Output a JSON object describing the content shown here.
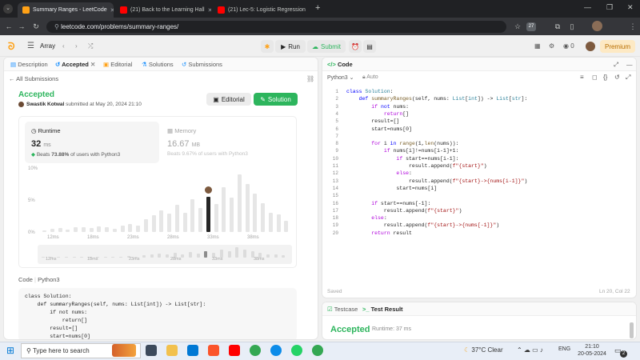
{
  "browser": {
    "tabs": [
      {
        "title": "Summary Ranges - LeetCode",
        "active": true
      },
      {
        "title": "(21) Back to the Learning Hall",
        "active": false
      },
      {
        "title": "(21) Lec-5: Logistic Regression",
        "active": false
      }
    ],
    "url": "leetcode.com/problems/summary-ranges/",
    "badge": "27"
  },
  "nav": {
    "list_label": "Array",
    "run_label": "Run",
    "submit_label": "Submit",
    "coins": "0",
    "premium_label": "Premium"
  },
  "left": {
    "tabs": [
      "Description",
      "Accepted",
      "Editorial",
      "Solutions",
      "Submissions"
    ],
    "back_label": "All Submissions",
    "status": "Accepted",
    "author": "Swastik Kotwal",
    "submitted_text": "submitted at May 20, 2024 21:10",
    "editorial_btn": "Editorial",
    "solution_btn": "Solution",
    "runtime": {
      "label": "Runtime",
      "value": "32",
      "unit": "ms",
      "beats_prefix": "Beats",
      "beats_value": "73.88%",
      "beats_suffix": "of users with Python3"
    },
    "memory": {
      "label": "Memory",
      "value": "16.67",
      "unit": "MB",
      "beats_text": "Beats 9.67% of users with Python3"
    },
    "code_label": "Code",
    "lang_label": "Python3",
    "code_preview": [
      "class Solution:",
      "    def summaryRanges(self, nums: List[int]) -> List[str]:",
      "        if not nums:",
      "            return[]",
      "        result=[]",
      "        start=nums[0]"
    ]
  },
  "chart_data": {
    "type": "bar",
    "ylabels": [
      "10%",
      "5%",
      "0%"
    ],
    "xlabels": [
      "12ms",
      "18ms",
      "23ms",
      "28ms",
      "33ms",
      "38ms"
    ],
    "mini_xlabels": [
      "12ms",
      "18ms",
      "23ms",
      "28ms",
      "33ms",
      "38ms"
    ],
    "ylim": [
      0,
      10
    ],
    "values": [
      0.3,
      0.5,
      0.6,
      0.4,
      0.8,
      0.7,
      0.6,
      0.9,
      0.8,
      0.5,
      1.0,
      1.2,
      1.0,
      2.0,
      2.6,
      3.4,
      2.9,
      4.2,
      3.0,
      5.1,
      3.7,
      5.5,
      4.4,
      7.0,
      5.4,
      9.0,
      7.5,
      6.0,
      4.5,
      3.0,
      2.8,
      1.8
    ],
    "highlight_index": 21
  },
  "editor": {
    "title": "Code",
    "lang": "Python3",
    "mode": "Auto",
    "saved_label": "Saved",
    "cursor_pos": "Ln 20, Col 22"
  },
  "code_lines": [
    {
      "n": "1",
      "html": "<span class='kb'>class</span> <span class='ty'>Solution</span>:"
    },
    {
      "n": "2",
      "html": "    <span class='kb'>def</span> <span class='fn'>summaryRanges</span>(self, nums: <span class='ty'>List</span>[<span class='ty'>int</span>]) -> <span class='ty'>List</span>[<span class='ty'>str</span>]:"
    },
    {
      "n": "3",
      "html": "        <span class='kw'>if</span> <span class='kb'>not</span> nums:"
    },
    {
      "n": "4",
      "html": "            <span class='kw'>return</span>[]"
    },
    {
      "n": "5",
      "html": "        result=[]"
    },
    {
      "n": "6",
      "html": "        start=nums[0]"
    },
    {
      "n": "7",
      "html": ""
    },
    {
      "n": "8",
      "html": "        <span class='kw'>for</span> i <span class='kb'>in</span> <span class='fn'>range</span>(1,<span class='fn'>len</span>(nums)):"
    },
    {
      "n": "9",
      "html": "            <span class='kw'>if</span> nums[i]!=nums[i-1]+1:"
    },
    {
      "n": "10",
      "html": "                <span class='kw'>if</span> start==nums[i-1]:"
    },
    {
      "n": "11",
      "html": "                    result.append(<span class='st'>f\"{start}\"</span>)"
    },
    {
      "n": "12",
      "html": "                <span class='kw'>else</span>:"
    },
    {
      "n": "13",
      "html": "                    result.append(<span class='st'>f\"{start}->{nums[i-1]}\"</span>)"
    },
    {
      "n": "14",
      "html": "                start=nums[i]"
    },
    {
      "n": "15",
      "html": ""
    },
    {
      "n": "16",
      "html": "        <span class='kw'>if</span> start==nums[-1]:"
    },
    {
      "n": "17",
      "html": "            result.append(<span class='st'>f\"{start}\"</span>)"
    },
    {
      "n": "18",
      "html": "        <span class='kw'>else</span>:"
    },
    {
      "n": "19",
      "html": "            result.append(<span class='st'>f\"{start}->{nums[-1]}\"</span>)"
    },
    {
      "n": "20",
      "html": "        <span class='kw'>return</span> result"
    }
  ],
  "bottom": {
    "testcase_tab": "Testcase",
    "result_tab": "Test Result",
    "status": "Accepted",
    "runtime_text": "Runtime: 37 ms"
  },
  "taskbar": {
    "search_placeholder": "Type here to search",
    "weather": "37°C  Clear",
    "lang": "ENG",
    "time": "21:10",
    "date": "20-05-2024",
    "notif": "2"
  },
  "colors": {
    "accent_green": "#2db55d",
    "leetcode_orange": "#ffa116",
    "highlight_bar": "#262626"
  }
}
